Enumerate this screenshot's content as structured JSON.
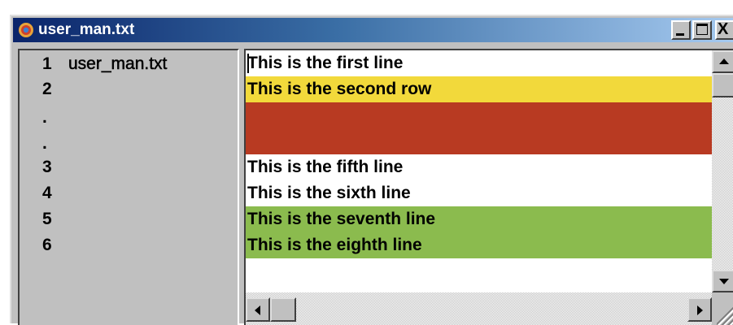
{
  "window": {
    "title": "user_man.txt",
    "icon": "app-circle-icon"
  },
  "title_buttons": {
    "minimize_icon": "minimize-icon",
    "maximize_icon": "maximize-icon",
    "close_glyph": "X"
  },
  "left_pane": {
    "rows": [
      {
        "num": "1",
        "name": "user_man.txt"
      },
      {
        "num": "2",
        "name": ""
      },
      {
        "num": ".",
        "name": ""
      },
      {
        "num": ".",
        "name": ""
      },
      {
        "num": "3",
        "name": ""
      },
      {
        "num": "4",
        "name": ""
      },
      {
        "num": "5",
        "name": ""
      },
      {
        "num": "6",
        "name": ""
      }
    ]
  },
  "lines": [
    {
      "text": "This is the first line",
      "bg": "#ffffff"
    },
    {
      "text": "This is the second row",
      "bg": "#f2d93b"
    },
    {
      "text": "",
      "bg": "#b83a22"
    },
    {
      "text": "",
      "bg": "#b83a22"
    },
    {
      "text": "This is the fifth line",
      "bg": "#ffffff"
    },
    {
      "text": "This is the sixth line",
      "bg": "#ffffff"
    },
    {
      "text": "This is the seventh line",
      "bg": "#8bbb4e"
    },
    {
      "text": "This is the eighth line",
      "bg": "#8bbb4e"
    }
  ],
  "colors": {
    "title_start": "#0a246a",
    "title_end": "#a6caf0",
    "yellow": "#f2d93b",
    "red": "#b83a22",
    "green": "#8bbb4e",
    "chrome": "#c0c0c0"
  }
}
